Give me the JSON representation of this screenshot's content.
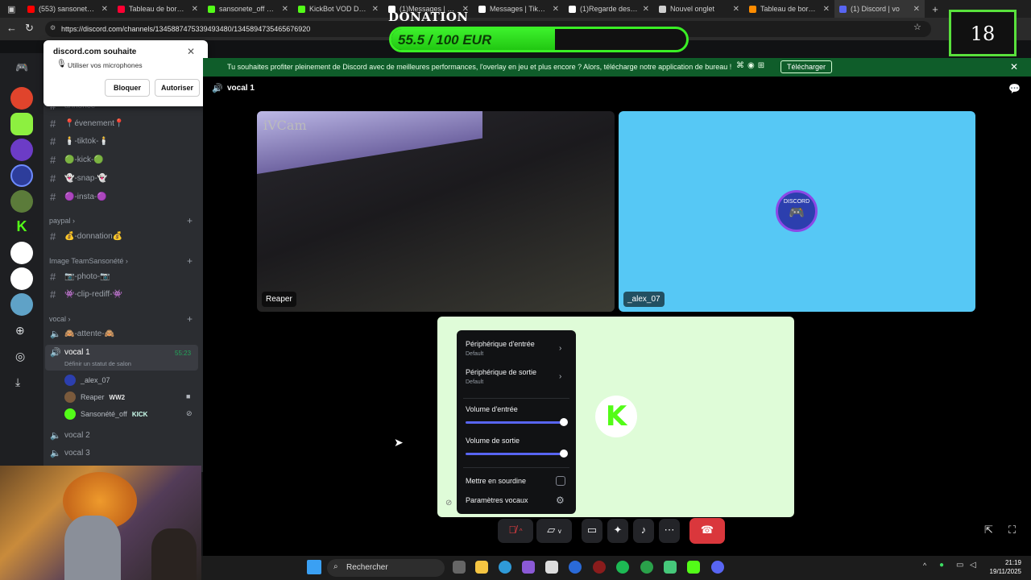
{
  "browser": {
    "tabs": [
      {
        "title": "(553) sansonete_off",
        "color": "#ff0000"
      },
      {
        "title": "Tableau de bord de",
        "color": "#ff0033"
      },
      {
        "title": "sansonete_off Strea",
        "color": "#53fc18"
      },
      {
        "title": "KickBot VOD Downl",
        "color": "#53fc18"
      },
      {
        "title": "(1)Messages | TikTo",
        "color": "#ffffff"
      },
      {
        "title": "Messages | TikTok",
        "color": "#ffffff"
      },
      {
        "title": "(1)Regarde des vidé",
        "color": "#ffffff"
      },
      {
        "title": "Nouvel onglet",
        "color": "#cfcfcf"
      },
      {
        "title": "Tableau de bord - [",
        "color": "#ff8c00"
      },
      {
        "title": "(1) Discord | vo",
        "color": "#5865f2"
      }
    ],
    "url": "https://discord.com/channels/1345887475339493480/1345894735465676920"
  },
  "overlay": {
    "donation_title": "DONATION",
    "donation_text": "55.5 / 100 EUR",
    "donation_progress": 0.555,
    "counter": "18"
  },
  "permission": {
    "title": "discord.com souhaite",
    "message": "Utiliser vos microphones",
    "block": "Bloquer",
    "allow": "Autoriser"
  },
  "banner": {
    "text": "Tu souhaites profiter pleinement de Discord avec de meilleures performances, l'overlay en jeu et plus encore ? Alors, télécharge notre application de bureau !",
    "download": "Télécharger"
  },
  "channels": {
    "partial": "annonce",
    "text_channels": [
      "📍évenement📍",
      "🕯️-tiktok-🕯️",
      "🟢-kick-🟢",
      "👻-snap-👻",
      "🟣-insta-🟣"
    ],
    "categories": {
      "paypal": "paypal",
      "image": "Image TeamSansonété",
      "vocal": "vocal"
    },
    "donation": "💰-donnation💰",
    "photo": "📷-photo-📷",
    "clip": "👾-clip-rediff-👾",
    "attente": "🙈-attente-🙈",
    "vocal1": "vocal 1",
    "vocal1_timer": "55:23",
    "vocal1_status": "Définir un statut de salon",
    "members": [
      {
        "name": "_alex_07",
        "badge": ""
      },
      {
        "name": "Reaper",
        "badge": "WW2"
      },
      {
        "name": "Sansonété_off",
        "badge": "KICK"
      }
    ],
    "vocal2": "vocal 2",
    "vocal3": "vocal 3"
  },
  "voice": {
    "title": "vocal 1",
    "tiles": {
      "reaper": "Reaper",
      "ivcam": "iVCam",
      "alex": "_alex_07",
      "alex_avatar_text": "DISCORD"
    }
  },
  "audio_menu": {
    "input_device": "Périphérique d'entrée",
    "input_default": "Default",
    "output_device": "Périphérique de sortie",
    "output_default": "Default",
    "input_volume": "Volume d'entrée",
    "output_volume": "Volume de sortie",
    "input_level": 1.0,
    "output_level": 1.0,
    "mute": "Mettre en sourdine",
    "settings": "Paramètres vocaux"
  },
  "taskbar": {
    "search": "Rechercher",
    "time": "21:19",
    "date": "19/11/2025"
  }
}
